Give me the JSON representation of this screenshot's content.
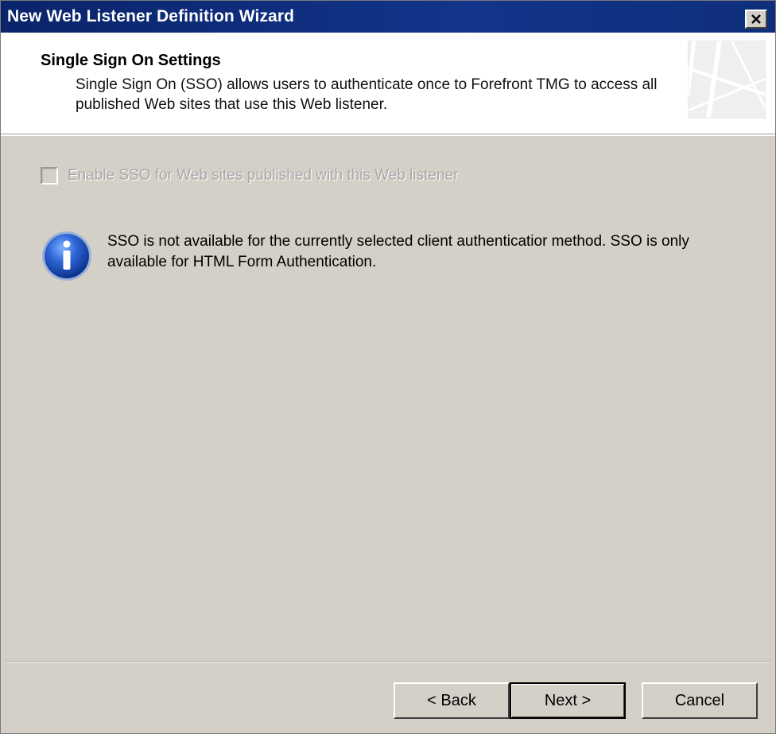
{
  "window": {
    "title": "New Web Listener Definition Wizard"
  },
  "header": {
    "title": "Single Sign On Settings",
    "description": "Single Sign On (SSO) allows users to authenticate once to Forefront TMG to access all published Web sites that use this Web listener."
  },
  "sso_checkbox": {
    "label": "Enable SSO for Web sites published with this Web listener",
    "checked": false,
    "enabled": false
  },
  "info": {
    "icon": "info-icon",
    "message": "SSO is not available for the currently selected client authenticatior method. SSO is only available for HTML Form Authentication."
  },
  "buttons": {
    "back": "< Back",
    "next": "Next >",
    "cancel": "Cancel"
  },
  "colors": {
    "titlebar": "#0a246a",
    "dialog_bg": "#d4d0c8",
    "info_blue": "#1c4fbf"
  }
}
